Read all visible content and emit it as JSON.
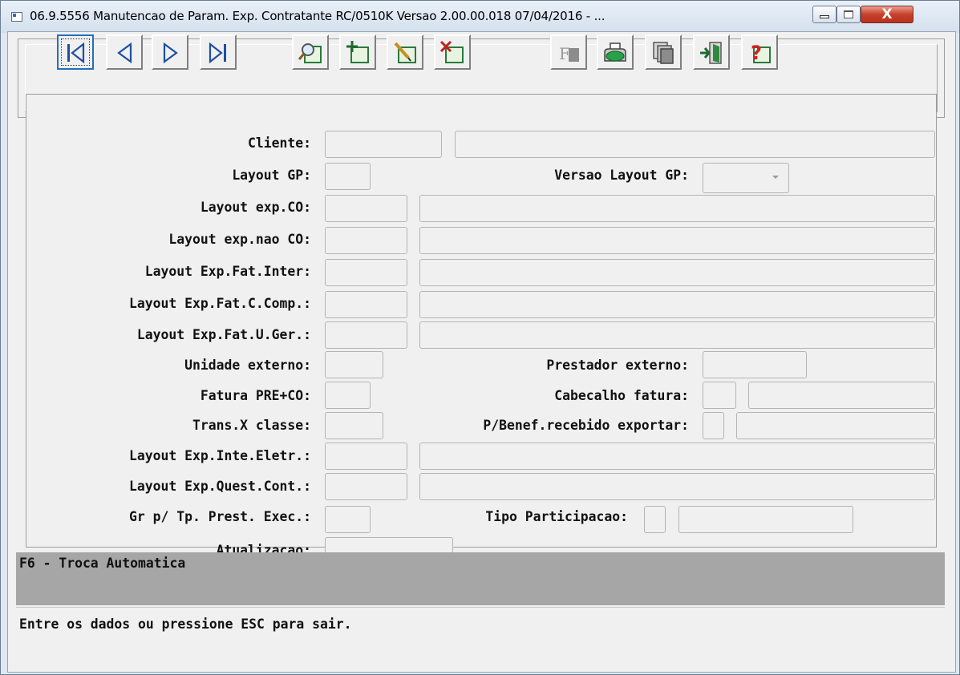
{
  "window": {
    "title": "06.9.5556 Manutencao  de Param. Exp. Contratante RC/0510K Versao 2.00.00.018 07/04/2016 - ...",
    "close_glyph": "X"
  },
  "toolbar": {
    "buttons": [
      {
        "name": "first-record",
        "icon": "first-icon"
      },
      {
        "name": "previous-record",
        "icon": "previous-icon"
      },
      {
        "name": "next-record",
        "icon": "next-icon"
      },
      {
        "name": "last-record",
        "icon": "last-icon"
      },
      {
        "name": "search",
        "icon": "magnifier-icon"
      },
      {
        "name": "add",
        "icon": "add-icon"
      },
      {
        "name": "edit",
        "icon": "edit-icon"
      },
      {
        "name": "delete",
        "icon": "delete-icon"
      },
      {
        "name": "format",
        "icon": "format-icon"
      },
      {
        "name": "print",
        "icon": "printer-icon"
      },
      {
        "name": "copy",
        "icon": "copy-icon"
      },
      {
        "name": "exit",
        "icon": "exit-door-icon"
      },
      {
        "name": "help",
        "icon": "help-question-icon"
      }
    ]
  },
  "form": {
    "cliente": {
      "label": "Cliente:",
      "code": "",
      "desc": ""
    },
    "layout_gp": {
      "label": "Layout GP:",
      "value": ""
    },
    "versao_layout_gp": {
      "label": "Versao Layout GP:",
      "value": ""
    },
    "layout_exp_co": {
      "label": "Layout exp.CO:",
      "code": "",
      "desc": ""
    },
    "layout_exp_nao_co": {
      "label": "Layout exp.nao CO:",
      "code": "",
      "desc": ""
    },
    "layout_exp_fat_inter": {
      "label": "Layout Exp.Fat.Inter:",
      "code": "",
      "desc": ""
    },
    "layout_exp_fat_c_comp": {
      "label": "Layout Exp.Fat.C.Comp.:",
      "code": "",
      "desc": ""
    },
    "layout_exp_fat_u_ger": {
      "label": "Layout Exp.Fat.U.Ger.:",
      "code": "",
      "desc": ""
    },
    "unidade_externo": {
      "label": "Unidade externo:",
      "value": ""
    },
    "prestador_externo": {
      "label": "Prestador externo:",
      "value": ""
    },
    "fatura_pre_co": {
      "label": "Fatura PRE+CO:",
      "value": ""
    },
    "cabecalho_fatura": {
      "label": "Cabecalho fatura:",
      "code": "",
      "desc": ""
    },
    "trans_x_classe": {
      "label": "Trans.X classe:",
      "value": ""
    },
    "p_benef_recebido_exportar": {
      "label": "P/Benef.recebido exportar:",
      "code": "",
      "desc": ""
    },
    "layout_exp_inte_eletr": {
      "label": "Layout Exp.Inte.Eletr.:",
      "code": "",
      "desc": ""
    },
    "layout_exp_quest_cont": {
      "label": "Layout Exp.Quest.Cont.:",
      "code": "",
      "desc": ""
    },
    "gr_tp_prest_exec": {
      "label": "Gr p/ Tp. Prest. Exec.:",
      "value": ""
    },
    "tipo_participacao": {
      "label": "Tipo Participacao:",
      "code": "",
      "desc": ""
    },
    "atualizacao": {
      "label": "Atualizacao:",
      "value": ""
    }
  },
  "help": {
    "text": "F6 - Troca Automatica"
  },
  "status": {
    "text": "Entre os dados ou pressione ESC para sair."
  }
}
